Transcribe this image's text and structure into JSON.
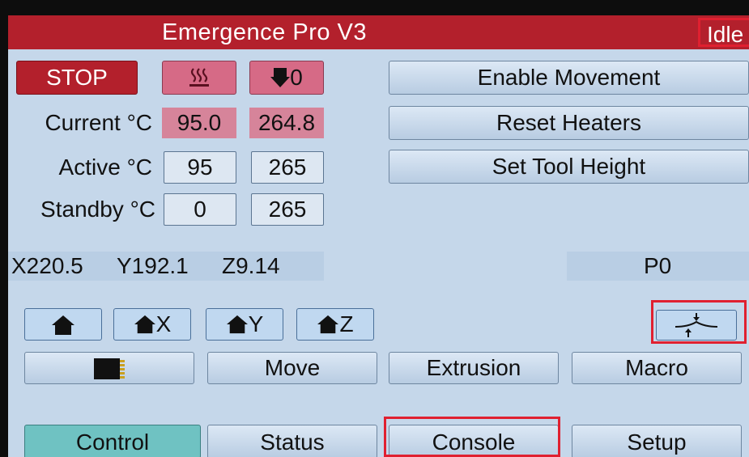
{
  "header": {
    "title": "Emergence Pro V3",
    "status": "Idle"
  },
  "controls": {
    "stop_label": "STOP",
    "fan_value": "0"
  },
  "rows": {
    "current_label": "Current °C",
    "active_label": "Active °C",
    "standby_label": "Standby °C",
    "current": [
      "95.0",
      "264.8"
    ],
    "active": [
      "95",
      "265"
    ],
    "standby": [
      "0",
      "265"
    ]
  },
  "actions": {
    "enable_movement": "Enable Movement",
    "reset_heaters": "Reset Heaters",
    "set_tool_height": "Set Tool Height"
  },
  "position": {
    "x": "X220.5",
    "y": "Y192.1",
    "z": "Z9.14",
    "p": "P0"
  },
  "home": {
    "x": "X",
    "y": "Y",
    "z": "Z"
  },
  "nav": {
    "move": "Move",
    "extrusion": "Extrusion",
    "macro": "Macro"
  },
  "tabs": {
    "control": "Control",
    "status": "Status",
    "console": "Console",
    "setup": "Setup"
  },
  "colors": {
    "title_bar": "#b3202c",
    "screen_bg": "#c5d7ea",
    "heater_value": "#d6849a",
    "highlight": "#e02030",
    "active_tab": "#6fc2c2"
  },
  "icons": [
    "heater-icon",
    "fan-icon",
    "home-icon",
    "sd-card-icon",
    "baby-step-icon"
  ]
}
